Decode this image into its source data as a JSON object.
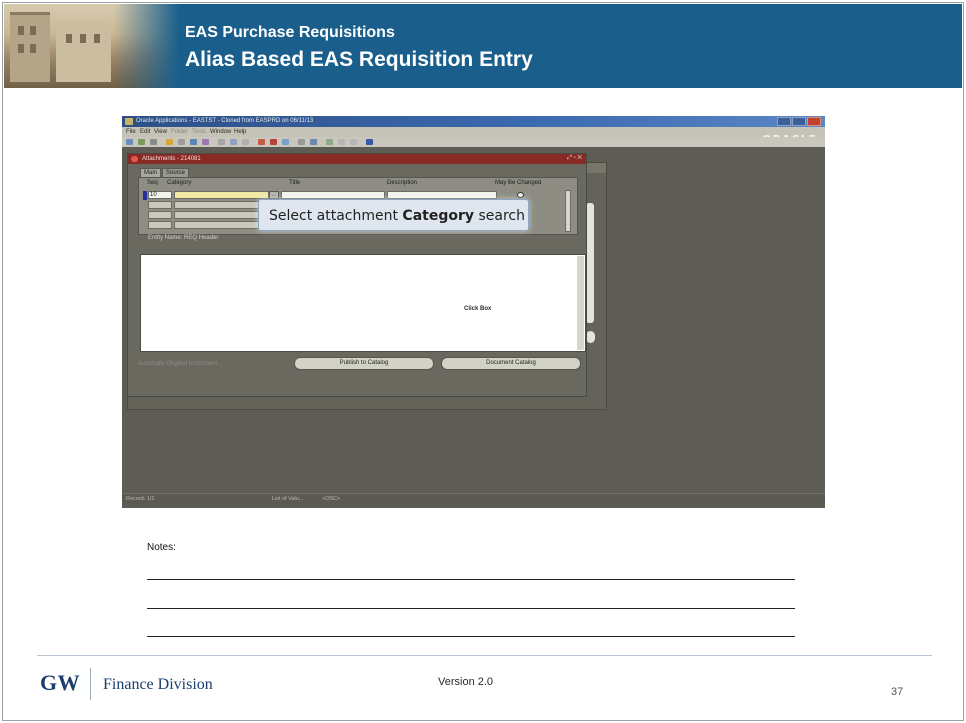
{
  "header": {
    "title_line1": "EAS Purchase Requisitions",
    "title_line2": "Alias Based EAS Requisition Entry",
    "banner_color": "#1a5f8c"
  },
  "oracle_window": {
    "title": "Oracle Applications - EASTST - Cloned from EASPRD on 06/11/13",
    "logo": "ORACLE",
    "menu": [
      "File",
      "Edit",
      "View",
      "Folder",
      "Tools",
      "Window",
      "Help"
    ],
    "status_bar": {
      "record": "Record: 1/1",
      "list_of_values": "List of Valu...",
      "osc": "<OSC>"
    }
  },
  "attachments": {
    "window_title": "Attachments - 214081",
    "tabs": [
      "Main",
      "Source"
    ],
    "columns": {
      "seq": "Seq",
      "category": "Category",
      "title": "Title",
      "description": "Description",
      "may_be_changed": "May Be Changed"
    },
    "row_seq": "10",
    "entity_name": "Entity Name: REQ Header",
    "textbox_label": "Click Box",
    "bottom_text": "Automatic Original Instrument...",
    "buttons": {
      "publish": "Publish to Catalog",
      "document_catalog": "Document Catalog"
    }
  },
  "tooltip": {
    "prefix": "Select attachment ",
    "bold": "Category",
    "suffix": " search"
  },
  "notes": {
    "label": "Notes:"
  },
  "footer": {
    "logo": "GW",
    "division": "Finance Division",
    "version": "Version 2.0",
    "page": "37"
  }
}
